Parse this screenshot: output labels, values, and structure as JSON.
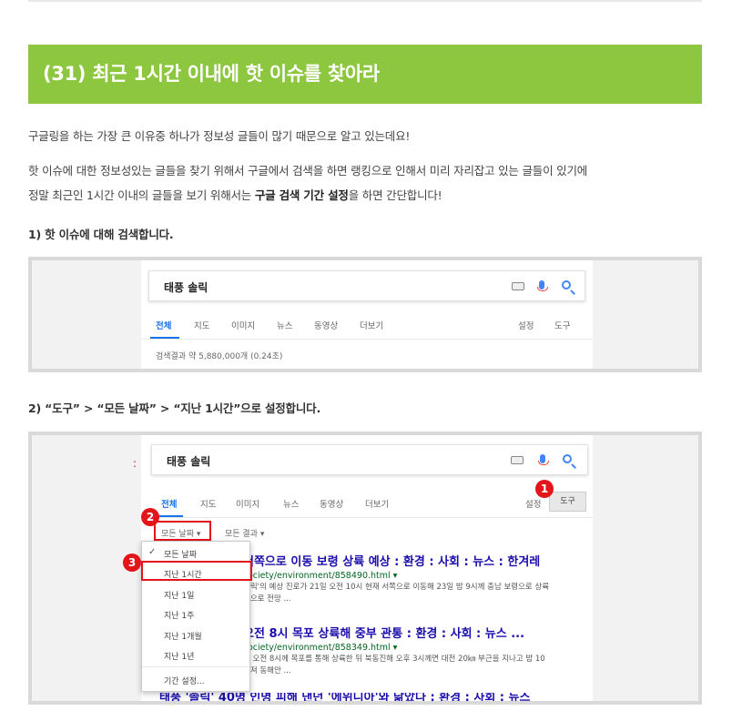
{
  "heading": "(31) 최근 1시간 이내에 핫 이슈를 찾아라",
  "paragraphs": {
    "p1": "구글링을 하는 가장 큰 이유중 하나가 정보성 글들이 많기 때문으로 알고 있는데요!",
    "p2_line1": "핫 이슈에 대한 정보성있는 글들을 찾기 위해서 구글에서 검색을 하면 랭킹으로 인해서 미리 자리잡고 있는 글들이 있기에",
    "p2_line2_pre": "정말 최근인 1시간 이내의 글들을 보기 위해서는 ",
    "p2_line2_bold": "구글 검색 기간 설정",
    "p2_line2_post": "을 하면 간단합니다!"
  },
  "step1": "1) 핫 이슈에 대해 검색합니다.",
  "step2": "2) “도구” > “모든 날짜” > “지난 1시간”으로 설정합니다.",
  "screenshot1": {
    "query": "태풍 솔릭",
    "tabs": [
      "전체",
      "지도",
      "이미지",
      "뉴스",
      "동영상",
      "더보기"
    ],
    "right_tabs": [
      "설정",
      "도구"
    ],
    "result_stats": "검색결과 약 5,880,000개 (0.24초)"
  },
  "screenshot2": {
    "query": "태풍 솔릭",
    "tabs": [
      "전체",
      "지도",
      "이미지",
      "뉴스",
      "동영상",
      "더보기"
    ],
    "settings_label": "설정",
    "tools_label": "도구",
    "filter_date": "모든 날짜 ▾",
    "filter_results": "모든 결과 ▾",
    "badges": [
      "1",
      "2",
      "3"
    ],
    "menu_items": [
      "모든 날짜",
      "지난 1시간",
      "지난 1일",
      "지난 1주",
      "지난 1개월",
      "지난 1년",
      "기간 설정..."
    ],
    "results": [
      {
        "title": "서쪽으로 이동 보령 상륙 예상 : 환경 : 사회 : 뉴스 : 한겨레",
        "url": "society/environment/858490.html ▾",
        "desc1": "솔릭'의 예상 진로가 21일 오전 10시 현재 서쪽으로 이동해 23일 밤 9시께 충남 보령으로 상륙",
        "desc2": "것으로 전망 ..."
      },
      {
        "title": "오전 8시 목포 상륙해 중부 관통 : 환경 : 사회 : 뉴스 ...",
        "url": "society/environment/858349.html ▾",
        "desc1": "일 오전 8시께 목포를 통해 상륙한 뒤 북동진해 오후 3시께면 대전 20㎞ 부근을 지나고 밤 10",
        "desc2": "빠져 동해안 ..."
      },
      {
        "title": "태풍 '솔릭' 40명 인명 피해 낸던 '에위니아'와 닮았다 : 환경 : 사회 : 뉴스"
      }
    ]
  },
  "colors": {
    "banner": "#8dc63f",
    "accent": "#1a73e8",
    "badge": "#e3151b"
  }
}
